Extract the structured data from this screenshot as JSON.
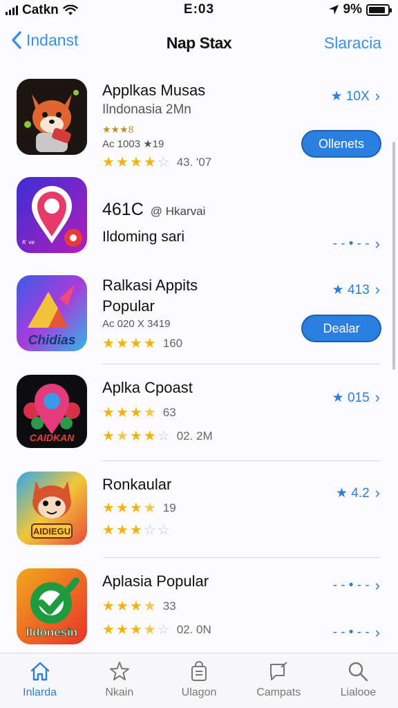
{
  "status_bar": {
    "carrier": "Catkn",
    "time": "E:03",
    "battery": "9%"
  },
  "nav": {
    "back_label": "Indanst",
    "title": "Nap Stax",
    "action_label": "Slaracia"
  },
  "apps": [
    {
      "name": "Applkas Musas",
      "subtitle": "Ilndonasia 2Mn",
      "meta1": "★★★8",
      "meta2": "Ac 1003 ★19",
      "rating_text": "43. '07",
      "price": "★ 10X",
      "button": "Ollenets"
    },
    {
      "name": "461C",
      "name_extra": "@ Hkarvai",
      "subtitle": "Ildoming sari",
      "price": "- - • - -"
    },
    {
      "name": "Ralkasi Appits",
      "name2": "Popular",
      "meta": "Ac 020 X 3419",
      "rating_text": "160",
      "price": "★ 413",
      "button": "Dealar"
    },
    {
      "name": "Aplka Cpoast",
      "rating1": "63",
      "rating2": "02. 2M",
      "price": "★ 015"
    },
    {
      "name": "Ronkaular",
      "rating1": "19",
      "price": "★ 4.2"
    },
    {
      "name": "Aplasia Popular",
      "rating1": "33",
      "rating2": "02. 0N",
      "price": "- - • - -"
    }
  ],
  "icon_labels": {
    "app3": "Chidias",
    "app4": "CAIDKAN",
    "app5": "AIDIEGU",
    "app6": "Ildonesin"
  },
  "tabs": [
    {
      "label": "Inlarda",
      "icon": "home-icon"
    },
    {
      "label": "Nkain",
      "icon": "star-icon"
    },
    {
      "label": "Ulagon",
      "icon": "bag-icon"
    },
    {
      "label": "Campats",
      "icon": "chat-icon"
    },
    {
      "label": "Lialooe",
      "icon": "search-icon"
    }
  ],
  "colors": {
    "accent": "#2b7fd9",
    "star": "#f2b40b",
    "button_bg": "#2a7fe0"
  }
}
